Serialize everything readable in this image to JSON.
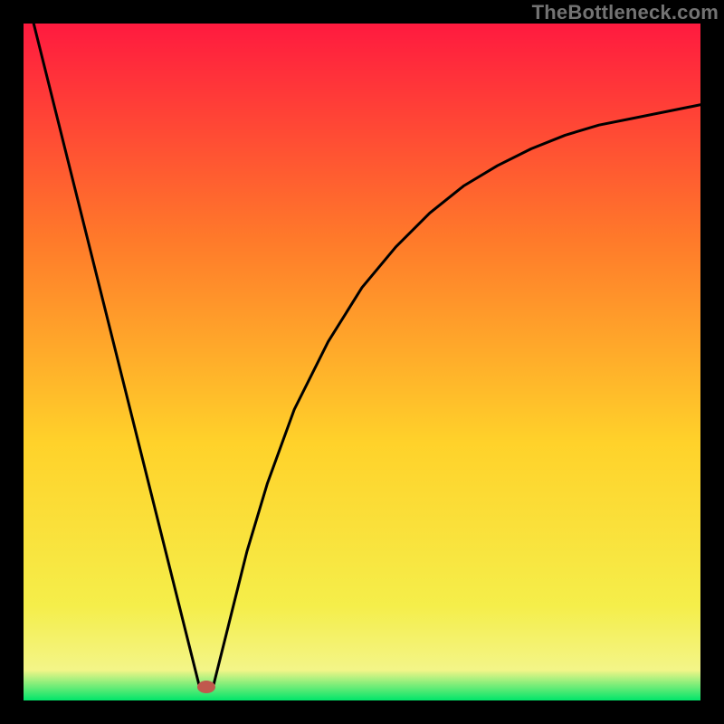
{
  "watermark": "TheBottleneck.com",
  "chart_data": {
    "type": "line",
    "title": "",
    "xlabel": "",
    "ylabel": "",
    "xlim": [
      0,
      100
    ],
    "ylim": [
      0,
      100
    ],
    "grid": false,
    "legend": false,
    "background_gradient": {
      "top_color": "#ff1a3f",
      "mid_upper_color": "#ff7a2a",
      "mid_color": "#ffd22a",
      "mid_lower_color": "#f5ee4a",
      "bottom_color": "#00e56a"
    },
    "series": [
      {
        "name": "left-descending-line",
        "x": [
          1.5,
          26
        ],
        "y": [
          100,
          2
        ]
      },
      {
        "name": "right-ascending-curve",
        "x": [
          28,
          30,
          33,
          36,
          40,
          45,
          50,
          55,
          60,
          65,
          70,
          75,
          80,
          85,
          90,
          95,
          100
        ],
        "y": [
          2,
          10,
          22,
          32,
          43,
          53,
          61,
          67,
          72,
          76,
          79,
          81.5,
          83.5,
          85,
          86,
          87,
          88
        ]
      }
    ],
    "marker": {
      "name": "minimum-marker",
      "x": 27,
      "y": 2,
      "color": "#c0594d"
    }
  }
}
